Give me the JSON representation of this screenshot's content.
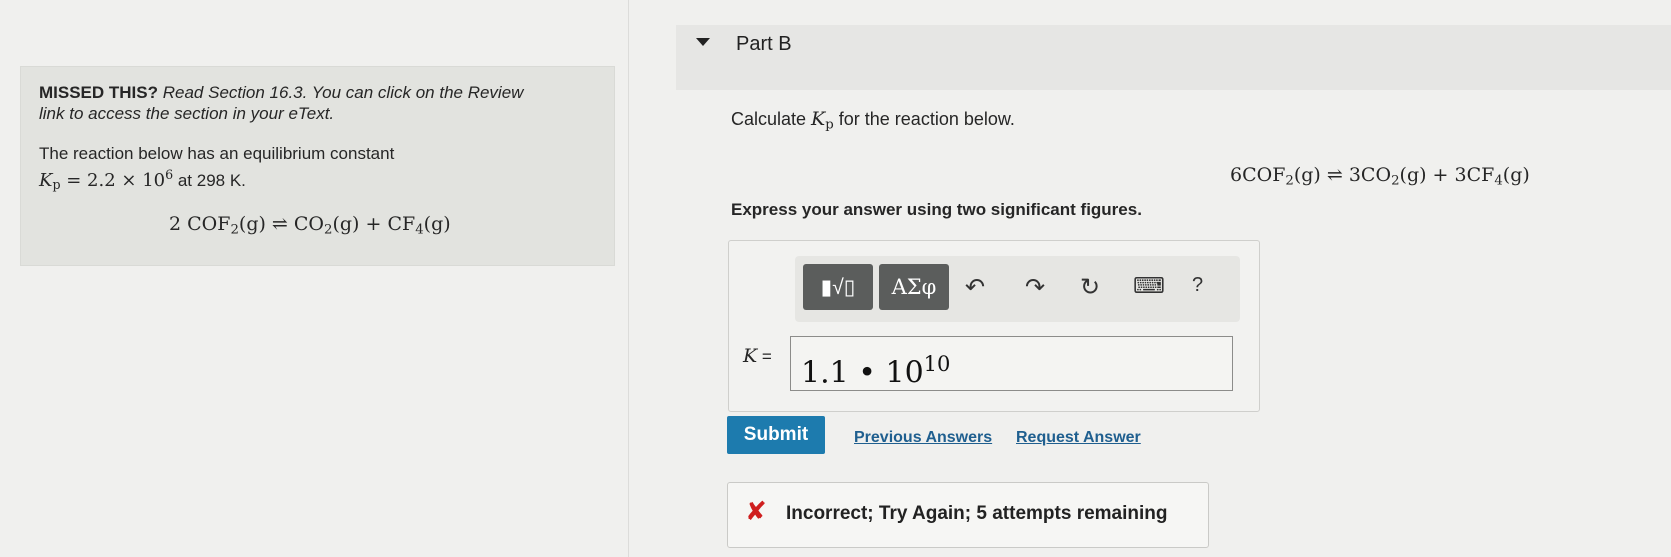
{
  "hint": {
    "missed_label": "MISSED THIS?",
    "read_text": "Read Section 16.3. You can click on the Review",
    "line2": "link to access the section in your eText.",
    "intro": "The reaction below has an equilibrium constant",
    "kp_symbol": "K",
    "kp_sub": "p",
    "kp_eq": " = 2.2 × 10",
    "kp_exp": "6",
    "kp_at": " at 298 K.",
    "eq_left": "2 COF",
    "eq_left_sub": "2",
    "eq_left_rest": "(g) ⇌ CO",
    "eq_co2_sub": "2",
    "eq_mid": "(g) + CF",
    "eq_cf4_sub": "4",
    "eq_end": "(g)"
  },
  "part": {
    "title": "Part B"
  },
  "question": {
    "prefix": "Calculate ",
    "k_symbol": "K",
    "k_sub": "p",
    "suffix": " for the reaction below.",
    "eq_a": "6COF",
    "eq_a_sub": "2",
    "eq_b": "(g) ⇌ 3CO",
    "eq_b_sub": "2",
    "eq_c": "(g) + 3CF",
    "eq_c_sub": "4",
    "eq_d": "(g)",
    "instructions": "Express your answer using two significant figures."
  },
  "toolbar": {
    "templates_label": "▮√▯",
    "greek_label": "ΑΣφ",
    "undo": "↶",
    "redo": "↷",
    "reset": "↻",
    "keyboard": "⌨",
    "help": "?"
  },
  "answer": {
    "label": "K",
    "equals": " =",
    "mantissa": "1.1 • 10",
    "exponent": "10"
  },
  "actions": {
    "submit": "Submit",
    "previous_answers": "Previous Answers",
    "request_answer": "Request Answer"
  },
  "feedback": {
    "icon": "✘",
    "text": "Incorrect; Try Again; 5 attempts remaining",
    "color": "#cf1f1f"
  }
}
